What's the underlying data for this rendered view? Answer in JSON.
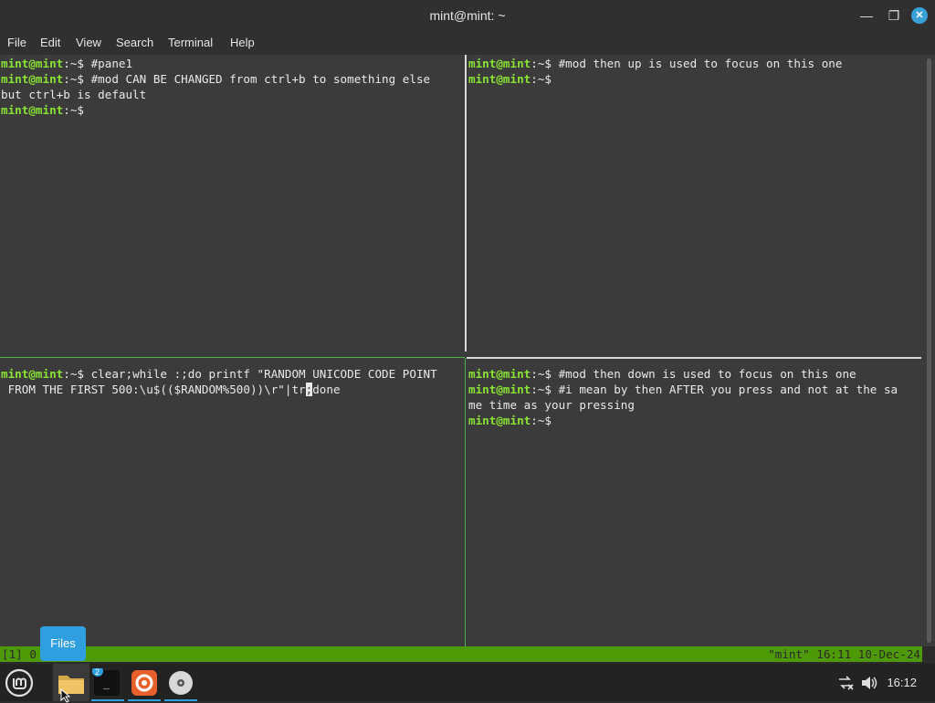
{
  "window": {
    "title": "mint@mint: ~",
    "minimize_icon": "minimize-icon",
    "maximize_icon": "maximize-icon",
    "close_icon": "close-icon"
  },
  "menu": [
    "File",
    "Edit",
    "View",
    "Search",
    "Terminal",
    "Help"
  ],
  "prompt": {
    "user": "mint@mint",
    "path": ":~$"
  },
  "panes": {
    "top_left": [
      {
        "prompt": true,
        "text": " #pane1"
      },
      {
        "prompt": true,
        "text": " #mod CAN BE CHANGED from ctrl+b to something else"
      },
      {
        "prompt": false,
        "text": "but ctrl+b is default"
      },
      {
        "prompt": true,
        "text": ""
      }
    ],
    "top_right": [
      {
        "prompt": true,
        "text": " #mod then up is used to focus on this one"
      },
      {
        "prompt": true,
        "text": ""
      }
    ],
    "bottom_left": [
      {
        "prompt": true,
        "text": " clear;while :;do printf \"RANDOM UNICODE CODE POINT"
      },
      {
        "prompt": false,
        "text": " FROM THE FIRST 500:\\u$(($RANDOM%500))\\r\"|tr",
        "cursor": ";",
        "after": "done"
      }
    ],
    "bottom_right": [
      {
        "prompt": true,
        "text": " #mod then down is used to focus on this one"
      },
      {
        "prompt": true,
        "text": " #i mean by then AFTER you press and not at the sa"
      },
      {
        "prompt": false,
        "text": "me time as your pressing"
      },
      {
        "prompt": true,
        "text": ""
      }
    ]
  },
  "status": {
    "left": "[1] 0",
    "right": "\"mint\" 16:11 10-Dec-24"
  },
  "tooltip": "Files",
  "taskbar": {
    "menu_icon": "linux-mint-menu-icon",
    "apps": [
      {
        "icon": "folder-icon",
        "active": true
      },
      {
        "icon": "terminal-icon",
        "badge": "2"
      },
      {
        "icon": "firefox-icon"
      },
      {
        "icon": "disc-icon"
      }
    ],
    "tray": [
      "network-disconnected-icon",
      "volume-icon"
    ],
    "clock": "16:12"
  },
  "colors": {
    "prompt": "#8ae234",
    "status_bar": "#4e9a06",
    "accent": "#2f9fe0"
  }
}
